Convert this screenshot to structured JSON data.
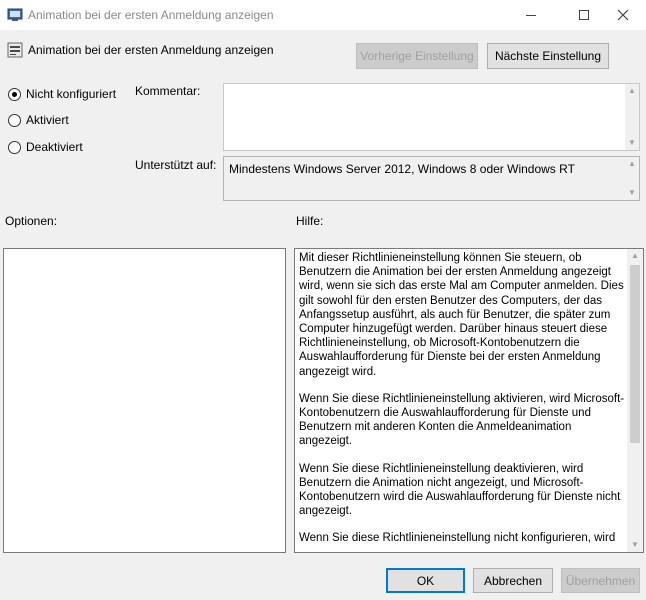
{
  "window": {
    "title": "Animation bei der ersten Anmeldung anzeigen",
    "min_glyph": "—",
    "max_glyph": "☐",
    "close_glyph": "✕"
  },
  "header": {
    "title": "Animation bei der ersten Anmeldung anzeigen",
    "prev_button": "Vorherige Einstellung",
    "next_button": "Nächste Einstellung"
  },
  "state": {
    "options": [
      {
        "label": "Nicht konfiguriert",
        "checked": true
      },
      {
        "label": "Aktiviert",
        "checked": false
      },
      {
        "label": "Deaktiviert",
        "checked": false
      }
    ]
  },
  "comment": {
    "label": "Kommentar:",
    "value": ""
  },
  "supported": {
    "label": "Unterstützt auf:",
    "value": "Mindestens Windows Server 2012, Windows 8 oder Windows RT"
  },
  "options_panel": {
    "label": "Optionen:"
  },
  "help_panel": {
    "label": "Hilfe:",
    "paragraphs": [
      "Mit dieser Richtlinieneinstellung können Sie steuern, ob Benutzern die Animation bei der ersten Anmeldung angezeigt wird, wenn sie sich das erste Mal am Computer anmelden.  Dies gilt sowohl für den ersten Benutzer des Computers, der das Anfangssetup ausführt, als auch für Benutzer, die später zum Computer hinzugefügt werden.  Darüber hinaus steuert diese Richtlinieneinstellung, ob Microsoft-Kontobenutzern die Auswahlaufforderung für Dienste bei der ersten Anmeldung angezeigt wird.",
      "Wenn Sie diese Richtlinieneinstellung aktivieren, wird Microsoft-Kontobenutzern die Auswahlaufforderung für Dienste und Benutzern mit anderen Konten die Anmeldeanimation angezeigt.",
      "Wenn Sie diese Richtlinieneinstellung deaktivieren, wird Benutzern die Animation nicht angezeigt, und Microsoft-Kontobenutzern wird die Auswahlaufforderung für Dienste nicht angezeigt.",
      "Wenn Sie diese Richtlinieneinstellung nicht konfigurieren, wird"
    ]
  },
  "footer": {
    "ok": "OK",
    "cancel": "Abbrechen",
    "apply": "Übernehmen"
  },
  "colors": {
    "accent": "#0078d7",
    "background": "#f0f0f0"
  }
}
